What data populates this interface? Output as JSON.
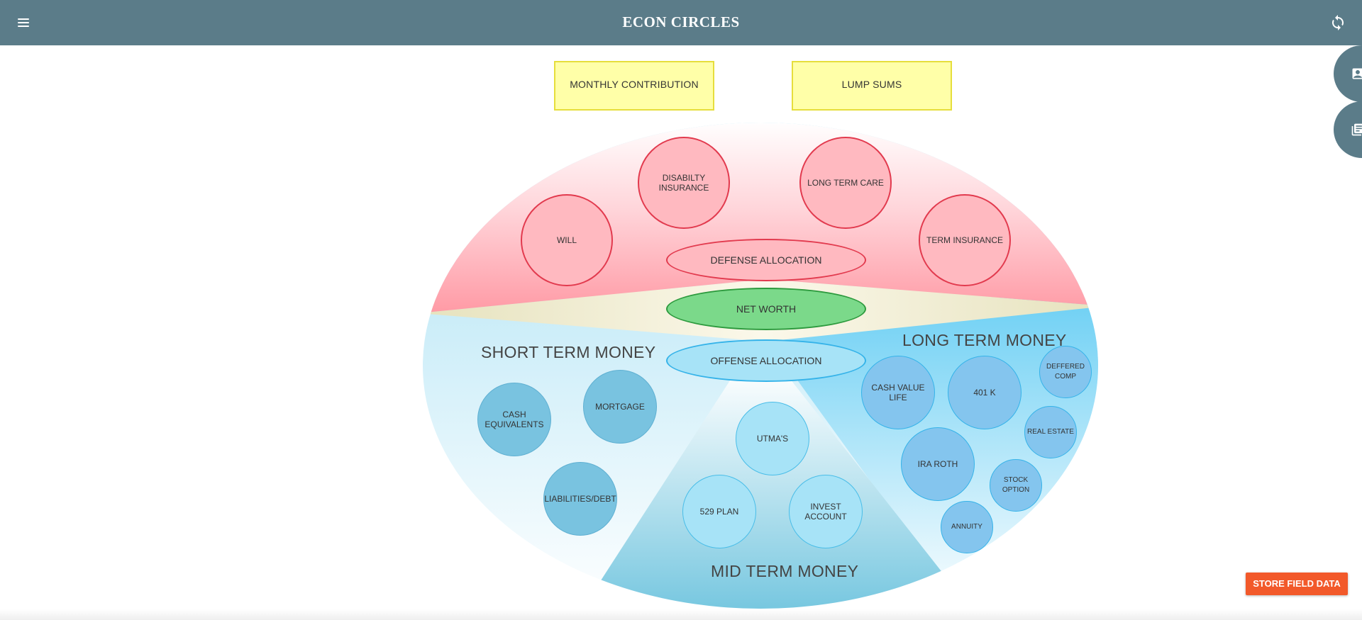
{
  "app": {
    "title": "ECON CIRCLES"
  },
  "sticky_notes": {
    "monthly": "MONTHLY CONTRIBUTION",
    "lump": "LUMP SUMS"
  },
  "defense": {
    "allocation_label": "DEFENSE ALLOCATION",
    "items": [
      "DISABILTY INSURANCE",
      "LONG TERM CARE",
      "WILL",
      "TERM INSURANCE"
    ]
  },
  "net_worth": "NET WORTH",
  "offense_allocation": "OFFENSE ALLOCATION",
  "short_term": {
    "title": "SHORT TERM MONEY",
    "items": [
      "CASH EQUIVALENTS",
      "MORTGAGE",
      "LIABILITIES/DEBT"
    ]
  },
  "long_term": {
    "title": "LONG TERM MONEY",
    "items": [
      "CASH VALUE LIFE",
      "401 K",
      "DEFFERED COMP",
      "REAL ESTATE",
      "IRA ROTH",
      "STOCK OPTION",
      "ANNUITY"
    ]
  },
  "mid_term": {
    "title": "MID TERM MONEY",
    "items": [
      "UTMA'S",
      "529 PLAN",
      "INVEST ACCOUNT"
    ]
  },
  "actions": {
    "store_field_data": "STORE FIELD DATA"
  },
  "icons": {
    "menu": "menu-icon",
    "sync": "sync-icon",
    "contact": "contact-card-icon",
    "library": "library-books-icon"
  },
  "colors": {
    "topbar": "#5b7c89",
    "defense": "#ffb9c0",
    "net_worth": "#7bd98a",
    "store_button": "#f2592a",
    "sticky": "#ffffa8"
  }
}
